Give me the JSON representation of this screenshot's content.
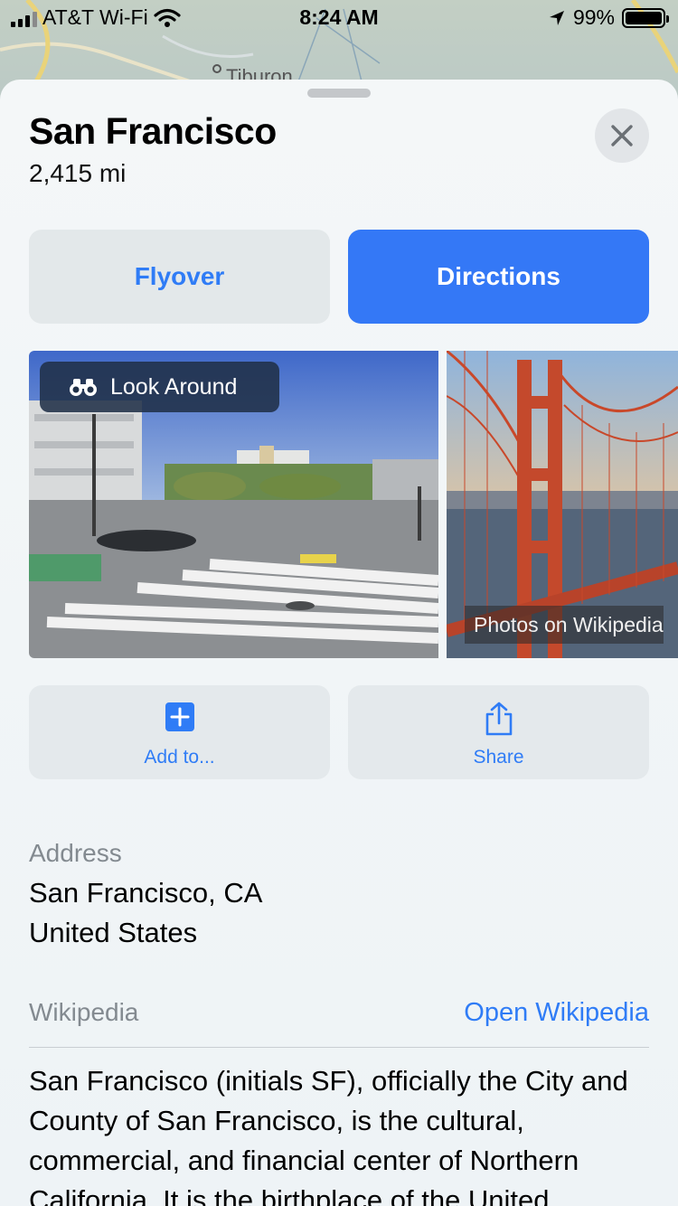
{
  "status_bar": {
    "carrier": "AT&T Wi-Fi",
    "time": "8:24 AM",
    "battery_percent": "99%",
    "battery_level": 0.99
  },
  "map": {
    "place_label": "Tiburon"
  },
  "sheet": {
    "title": "San Francisco",
    "distance": "2,415 mi",
    "close_icon": "close-icon"
  },
  "buttons": {
    "flyover": "Flyover",
    "directions": "Directions"
  },
  "photos": {
    "look_around_label": "Look Around",
    "look_around_icon": "binoculars-icon",
    "wikipedia_photos_label": "Photos on Wikipedia"
  },
  "actions": {
    "add_label": "Add to...",
    "add_icon": "plus-square-icon",
    "share_label": "Share",
    "share_icon": "share-icon"
  },
  "address": {
    "label": "Address",
    "line1": "San Francisco, CA",
    "line2": "United States"
  },
  "wikipedia": {
    "label": "Wikipedia",
    "open_link": "Open Wikipedia",
    "summary": "San Francisco (initials SF), officially the City and County of San Francisco, is the cultural, commercial, and financial center of Northern California. It is the birthplace of the United"
  },
  "colors": {
    "accent": "#3478f6",
    "link": "#2f7cf6",
    "secondary_text": "#838a90"
  }
}
